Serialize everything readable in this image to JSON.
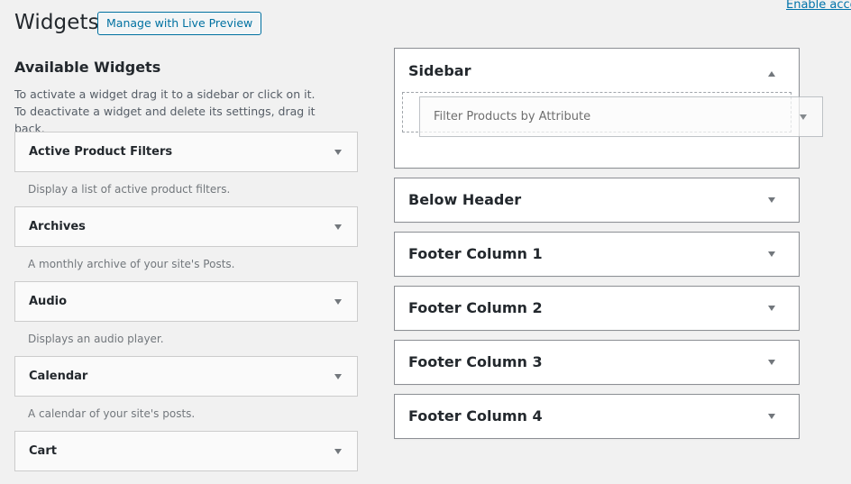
{
  "header": {
    "title": "Widgets",
    "live_preview_button": "Manage with Live Preview",
    "accessibility_link": "Enable accessibility mode"
  },
  "available": {
    "title": "Available Widgets",
    "description": "To activate a widget drag it to a sidebar or click on it. To deactivate a widget and delete its settings, drag it back.",
    "widgets": [
      {
        "title": "Active Product Filters",
        "description": "Display a list of active product filters."
      },
      {
        "title": "Archives",
        "description": "A monthly archive of your site's Posts."
      },
      {
        "title": "Audio",
        "description": "Displays an audio player."
      },
      {
        "title": "Calendar",
        "description": "A calendar of your site's posts."
      },
      {
        "title": "Cart",
        "description": ""
      }
    ]
  },
  "sidebars": [
    {
      "title": "Sidebar",
      "expanded": true
    },
    {
      "title": "Below Header",
      "expanded": false
    },
    {
      "title": "Footer Column 1",
      "expanded": false
    },
    {
      "title": "Footer Column 2",
      "expanded": false
    },
    {
      "title": "Footer Column 3",
      "expanded": false
    },
    {
      "title": "Footer Column 4",
      "expanded": false
    }
  ],
  "dragging_widget": {
    "title": "Filter Products by Attribute"
  },
  "colors": {
    "accent": "#0071a1",
    "background": "#f1f1f1",
    "link": "#0073aa"
  }
}
